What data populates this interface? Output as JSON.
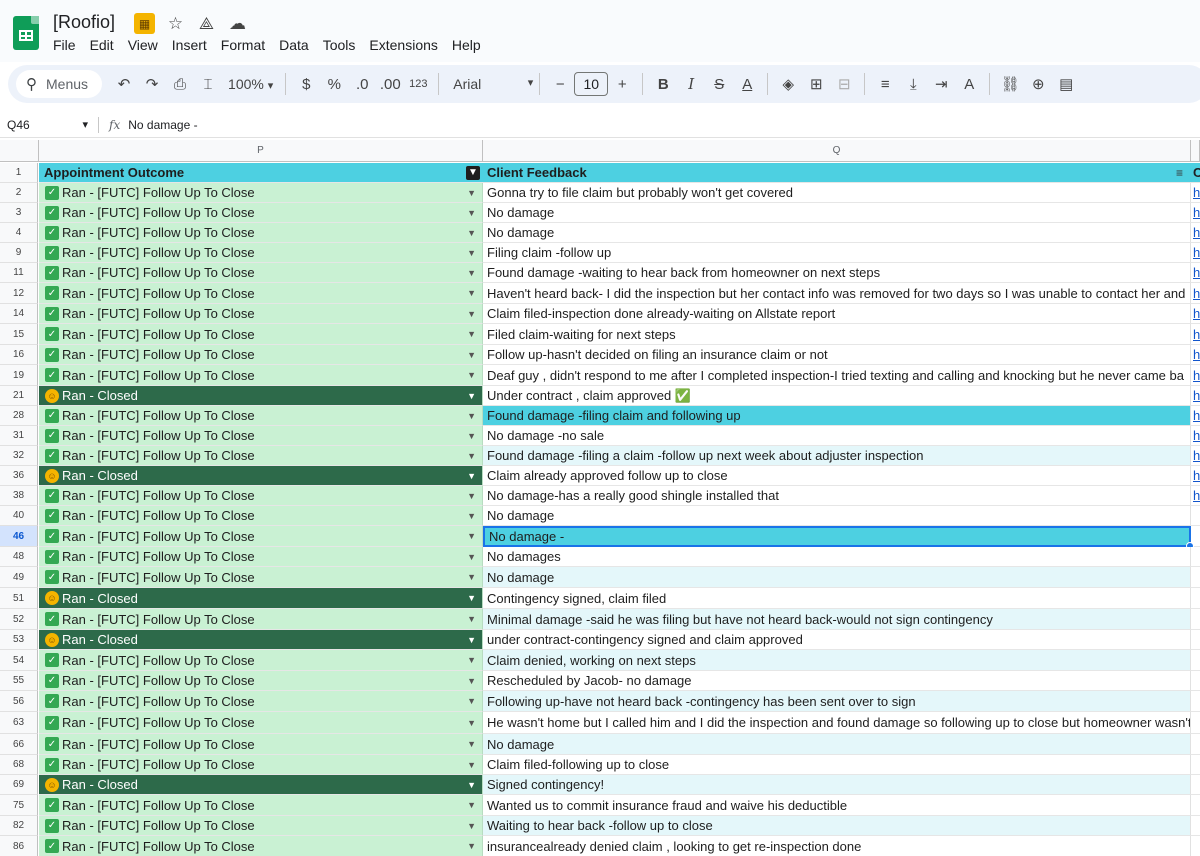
{
  "app": {
    "doc_title": "[Roofio]",
    "menus": [
      "File",
      "Edit",
      "View",
      "Insert",
      "Format",
      "Data",
      "Tools",
      "Extensions",
      "Help"
    ]
  },
  "toolbar": {
    "search_label": "Menus",
    "zoom": "100%",
    "currency": "$",
    "percent": "%",
    "dec_decrease": ".0",
    "dec_increase": ".00",
    "number_format": "123",
    "font": "Arial",
    "font_size": "10",
    "minus": "−",
    "plus": "+",
    "bold": "B",
    "italic": "I"
  },
  "formula_bar": {
    "cell_ref": "Q46",
    "fx": "fx",
    "content": "No damage -"
  },
  "columns": {
    "p_letter": "P",
    "q_letter": "Q",
    "p_header": "Appointment Outcome",
    "q_header": "Client Feedback",
    "r_header": "C"
  },
  "rows": [
    {
      "num": "2",
      "outcome": "Ran - [FUTC] Follow Up To Close",
      "closed": false,
      "feedback": "Gonna try to file claim but probably won't get covered",
      "style": "white",
      "link": "h"
    },
    {
      "num": "3",
      "outcome": "Ran - [FUTC] Follow Up To Close",
      "closed": false,
      "feedback": "No damage",
      "style": "white",
      "link": "h"
    },
    {
      "num": "4",
      "outcome": "Ran - [FUTC] Follow Up To Close",
      "closed": false,
      "feedback": "No damage",
      "style": "white",
      "link": "h"
    },
    {
      "num": "9",
      "outcome": "Ran - [FUTC] Follow Up To Close",
      "closed": false,
      "feedback": "Filing claim -follow up",
      "style": "white",
      "link": "h"
    },
    {
      "num": "11",
      "outcome": "Ran - [FUTC] Follow Up To Close",
      "closed": false,
      "feedback": "Found damage -waiting to hear back from homeowner on next steps",
      "style": "white",
      "link": "h"
    },
    {
      "num": "12",
      "outcome": "Ran - [FUTC] Follow Up To Close",
      "closed": false,
      "feedback": "Haven't heard back- I did the inspection but her contact info was removed for two days so I was unable to contact her and",
      "style": "white",
      "link": "h"
    },
    {
      "num": "14",
      "outcome": "Ran - [FUTC] Follow Up To Close",
      "closed": false,
      "feedback": "Claim filed-inspection done already-waiting on Allstate report",
      "style": "white",
      "link": "h"
    },
    {
      "num": "15",
      "outcome": "Ran - [FUTC] Follow Up To Close",
      "closed": false,
      "feedback": "Filed claim-waiting for next steps",
      "style": "white",
      "link": "h"
    },
    {
      "num": "16",
      "outcome": "Ran - [FUTC] Follow Up To Close",
      "closed": false,
      "feedback": "Follow up-hasn't decided on filing an insurance claim or not",
      "style": "white",
      "link": "h"
    },
    {
      "num": "19",
      "outcome": "Ran - [FUTC] Follow Up To Close",
      "closed": false,
      "feedback": "Deaf guy , didn't respond to me after I completed inspection-I tried texting and calling and knocking but he never came ba",
      "style": "white",
      "link": "h"
    },
    {
      "num": "21",
      "outcome": "Ran - Closed",
      "closed": true,
      "feedback": "Under contract , claim approved ✅",
      "style": "white",
      "link": "h"
    },
    {
      "num": "28",
      "outcome": "Ran - [FUTC] Follow Up To Close",
      "closed": false,
      "feedback": "Found damage -filing claim and following up",
      "style": "hl",
      "link": "h"
    },
    {
      "num": "31",
      "outcome": "Ran - [FUTC] Follow Up To Close",
      "closed": false,
      "feedback": "No damage -no sale",
      "style": "white",
      "link": "h"
    },
    {
      "num": "32",
      "outcome": "Ran - [FUTC] Follow Up To Close",
      "closed": false,
      "feedback": "Found damage -filing a claim -follow up next week about adjuster inspection",
      "style": "alt",
      "link": "h"
    },
    {
      "num": "36",
      "outcome": "Ran - Closed",
      "closed": true,
      "feedback": "Claim already approved follow up to close",
      "style": "white",
      "link": "h"
    },
    {
      "num": "38",
      "outcome": "Ran - [FUTC] Follow Up To Close",
      "closed": false,
      "feedback": "No damage-has a really good shingle installed that",
      "style": "white",
      "link": "h"
    },
    {
      "num": "40",
      "outcome": "Ran - [FUTC] Follow Up To Close",
      "closed": false,
      "feedback": "No damage",
      "style": "white",
      "link": ""
    },
    {
      "num": "46",
      "outcome": "Ran - [FUTC] Follow Up To Close",
      "closed": false,
      "feedback": "No damage -",
      "style": "active",
      "link": ""
    },
    {
      "num": "48",
      "outcome": "Ran - [FUTC] Follow Up To Close",
      "closed": false,
      "feedback": "No damages",
      "style": "white",
      "link": ""
    },
    {
      "num": "49",
      "outcome": "Ran - [FUTC] Follow Up To Close",
      "closed": false,
      "feedback": "No damage",
      "style": "alt",
      "link": ""
    },
    {
      "num": "51",
      "outcome": "Ran - Closed",
      "closed": true,
      "feedback": "Contingency signed, claim filed",
      "style": "white",
      "link": ""
    },
    {
      "num": "52",
      "outcome": "Ran - [FUTC] Follow Up To Close",
      "closed": false,
      "feedback": "Minimal damage -said he was filing but have not heard back-would not sign contingency",
      "style": "alt",
      "link": ""
    },
    {
      "num": "53",
      "outcome": "Ran - Closed",
      "closed": true,
      "feedback": "under contract-contingency signed and claim approved",
      "style": "white",
      "link": ""
    },
    {
      "num": "54",
      "outcome": "Ran - [FUTC] Follow Up To Close",
      "closed": false,
      "feedback": "Claim denied, working on next steps",
      "style": "alt",
      "link": ""
    },
    {
      "num": "55",
      "outcome": "Ran - [FUTC] Follow Up To Close",
      "closed": false,
      "feedback": "Rescheduled by Jacob- no damage",
      "style": "white",
      "link": ""
    },
    {
      "num": "56",
      "outcome": "Ran - [FUTC] Follow Up To Close",
      "closed": false,
      "feedback": "Following up-have not heard back -contingency has been sent over to sign",
      "style": "alt",
      "link": ""
    },
    {
      "num": "63",
      "outcome": "Ran - [FUTC] Follow Up To Close",
      "closed": false,
      "feedback": "He wasn't home but I called him and I did the inspection and found damage so following up to close but homeowner wasn't",
      "style": "white",
      "link": ""
    },
    {
      "num": "66",
      "outcome": "Ran - [FUTC] Follow Up To Close",
      "closed": false,
      "feedback": "No damage",
      "style": "alt",
      "link": ""
    },
    {
      "num": "68",
      "outcome": "Ran - [FUTC] Follow Up To Close",
      "closed": false,
      "feedback": "Claim filed-following up to close",
      "style": "white",
      "link": ""
    },
    {
      "num": "69",
      "outcome": "Ran - Closed",
      "closed": true,
      "feedback": "Signed contingency!",
      "style": "alt",
      "link": ""
    },
    {
      "num": "75",
      "outcome": "Ran - [FUTC] Follow Up To Close",
      "closed": false,
      "feedback": "Wanted us to commit insurance fraud and waive his deductible",
      "style": "white",
      "link": ""
    },
    {
      "num": "82",
      "outcome": "Ran - [FUTC] Follow Up To Close",
      "closed": false,
      "feedback": "Waiting to hear back -follow up to close",
      "style": "alt",
      "link": ""
    },
    {
      "num": "86",
      "outcome": "Ran - [FUTC] Follow Up To Close",
      "closed": false,
      "feedback": "insurancealready denied claim , looking to get re-inspection done",
      "style": "white",
      "link": ""
    }
  ],
  "colors": {
    "header_teal": "#4dd0e1",
    "futc_green": "#c9f1d3",
    "closed_dark": "#2d6a4a",
    "selection_blue": "#1a73e8"
  }
}
